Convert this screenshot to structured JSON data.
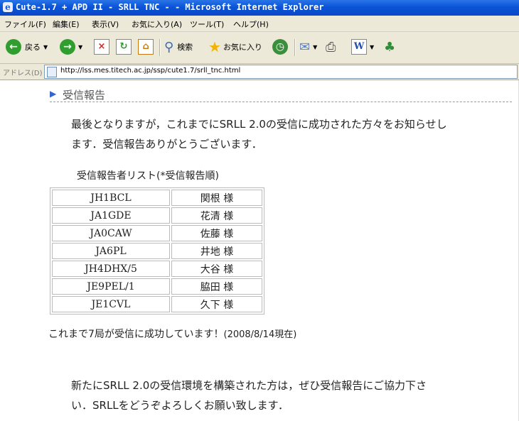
{
  "window": {
    "title": "Cute-1.7 + APD II - SRLL TNC - - Microsoft Internet Explorer"
  },
  "menu": [
    "ファイル(F)",
    "編集(E)",
    "表示(V)",
    "お気に入り(A)",
    "ツール(T)",
    "ヘルプ(H)"
  ],
  "toolbar": {
    "back_label": "戻る",
    "search_label": "検索",
    "favorites_label": "お気に入り"
  },
  "address": {
    "label": "アドレス(D)",
    "url": "http://lss.mes.titech.ac.jp/ssp/cute1.7/srll_tnc.html"
  },
  "page": {
    "heading": "受信報告",
    "intro_line1": "最後となりますが，これまでにSRLL 2.0の受信に成功された方々をお知らせし",
    "intro_line2": "ます．受信報告ありがとうございます．",
    "list_caption": "受信報告者リスト(*受信報告順)",
    "reports": [
      {
        "callsign": "JH1BCL",
        "name": "関根 様"
      },
      {
        "callsign": "JA1GDE",
        "name": "花清 様"
      },
      {
        "callsign": "JA0CAW",
        "name": "佐藤 様"
      },
      {
        "callsign": "JA6PL",
        "name": "井地 様"
      },
      {
        "callsign": "JH4DHX/5",
        "name": "大谷 様"
      },
      {
        "callsign": "JE9PEL/1",
        "name": "脇田 様"
      },
      {
        "callsign": "JE1CVL",
        "name": "久下 様"
      }
    ],
    "status_text": "これまで7局が受信に成功しています！",
    "status_date": "(2008/8/14現在)",
    "closing_line1": "新たにSRLL 2.0の受信環境を構築された方は，ぜひ受信報告にご協力下さ",
    "closing_line2": "い．SRLLをどうぞよろしくお願い致します．"
  }
}
